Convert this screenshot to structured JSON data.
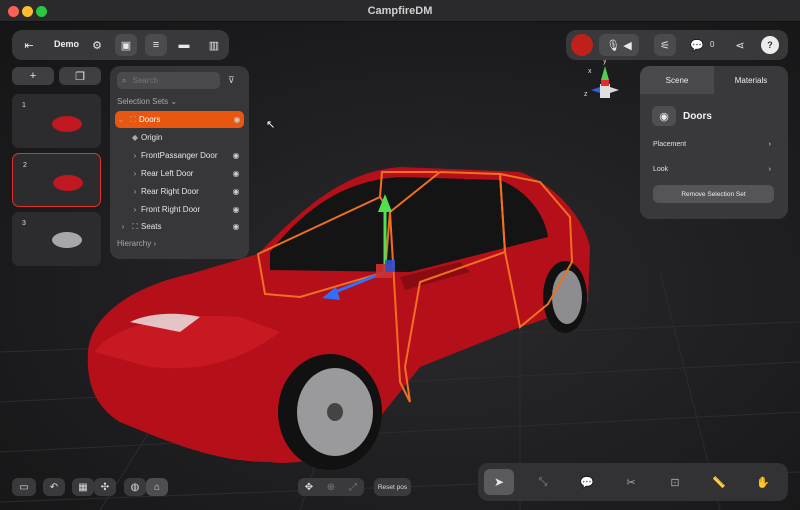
{
  "window": {
    "title": "CampfireDM"
  },
  "toolbar": {
    "project_name": "Demo"
  },
  "topright": {
    "count": "0"
  },
  "left": {
    "slides": [
      {
        "number": "1"
      },
      {
        "number": "2"
      },
      {
        "number": "3"
      }
    ]
  },
  "outline": {
    "search_placeholder": "Search",
    "section_label": "Selection Sets",
    "items": [
      {
        "label": "Doors"
      },
      {
        "label": "Origin"
      },
      {
        "label": "FrontPassanger Door"
      },
      {
        "label": "Rear Left Door"
      },
      {
        "label": "Rear Right Door"
      },
      {
        "label": "Front Right Door"
      },
      {
        "label": "Seats"
      }
    ],
    "hierarchy_label": "Hierarchy"
  },
  "rightpanel": {
    "tabs": [
      {
        "label": "Scene"
      },
      {
        "label": "Materials"
      }
    ],
    "selection_title": "Doors",
    "placement_label": "Placement",
    "look_label": "Look",
    "remove_label": "Remove Selection Set"
  },
  "bottom": {
    "reset_label": "Reset pos"
  },
  "gizmo": {
    "y": "y",
    "x": "x",
    "z": "z"
  },
  "colors": {
    "accent": "#e8560f",
    "panel": "#3c3c3e",
    "car": "#b5101a"
  }
}
